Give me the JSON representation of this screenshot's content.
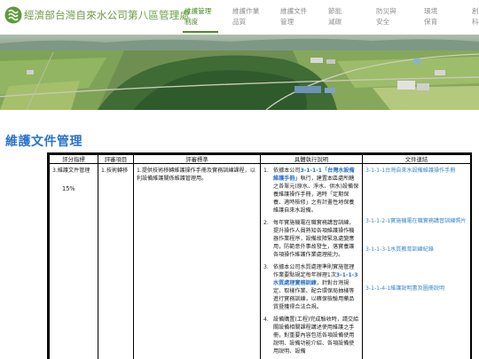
{
  "site": {
    "title": "經濟部台灣自來水公司第八區管理處",
    "brand_color": "#6a9c43",
    "accent": "#2a73c9"
  },
  "nav": [
    {
      "line1": "維護管理",
      "line2": "制度",
      "active": true
    },
    {
      "line1": "維護作業",
      "line2": "品質",
      "active": false
    },
    {
      "line1": "維護文件",
      "line2": "管理",
      "active": false
    },
    {
      "line1": "節能",
      "line2": "減碳",
      "active": false
    },
    {
      "line1": "防災與",
      "line2": "安全",
      "active": false
    },
    {
      "line1": "環境",
      "line2": "保育",
      "active": false
    },
    {
      "line1": "創新",
      "line2": "科技",
      "active": false
    }
  ],
  "section": {
    "title": "維護文件管理"
  },
  "table": {
    "headers": [
      "評分指標",
      "評審項目",
      "評審標準",
      "具體執行說明",
      "文件連結"
    ],
    "indicator": "3.維護文件管理",
    "weight": "15%",
    "item": "1.技術轉移",
    "standard": "1.提供技術移轉維護操作手冊及實務訓練課程，以利設備維護關係維護管理用。",
    "steps": [
      {
        "num": "1.",
        "pre": "依據本公司",
        "hl": "3-1-1-1「台灣水設備維護手冊」",
        "post": "執行，建置本區處所轄之各單元(原水、淨水、供水)設備保養維護操作手冊，適時「定期保養、適時檢修」之有計畫性地保養維護自來水設備。"
      },
      {
        "num": "2.",
        "pre": "每年實施機電在職實務講習訓練，提升操作人員熟知各項維護操作機器作業程序，設備故障緊急處變應用，防範意外事故發生，落實養護各項操作維護作業處理能力。",
        "hl": "",
        "post": ""
      },
      {
        "num": "3.",
        "pre": "依據本公司水質處理準則實施管理作業要點規定每年辦理1次",
        "hl": "3-1-1-3水質處理實務訓練",
        "post": "，針對台灣規定、取樣作業、配合環保局抽樣等進行實務訓練，以確保檢驗用藥品質暨獲得合法合規。"
      },
      {
        "num": "4.",
        "pre": "設備購置(工程)完成驗收時，請交給關設備相關課程講述使用維護之手冊，對重要內容包括",
        "hl": "",
        "post": "各項設備使用說明、設備功能介紹、各項設備使用說明、設備"
      }
    ],
    "links": [
      "3-1-1-1台灣自來水設備維護操作手冊",
      "3-1-1-2-1實施機電在職實務講習訓練照片",
      "3-1-1-3-1水質教育訓練紀錄",
      "3-1-1-4-1維護說明書及圖冊說明"
    ]
  },
  "icons": {
    "logo": "water-company-logo"
  }
}
